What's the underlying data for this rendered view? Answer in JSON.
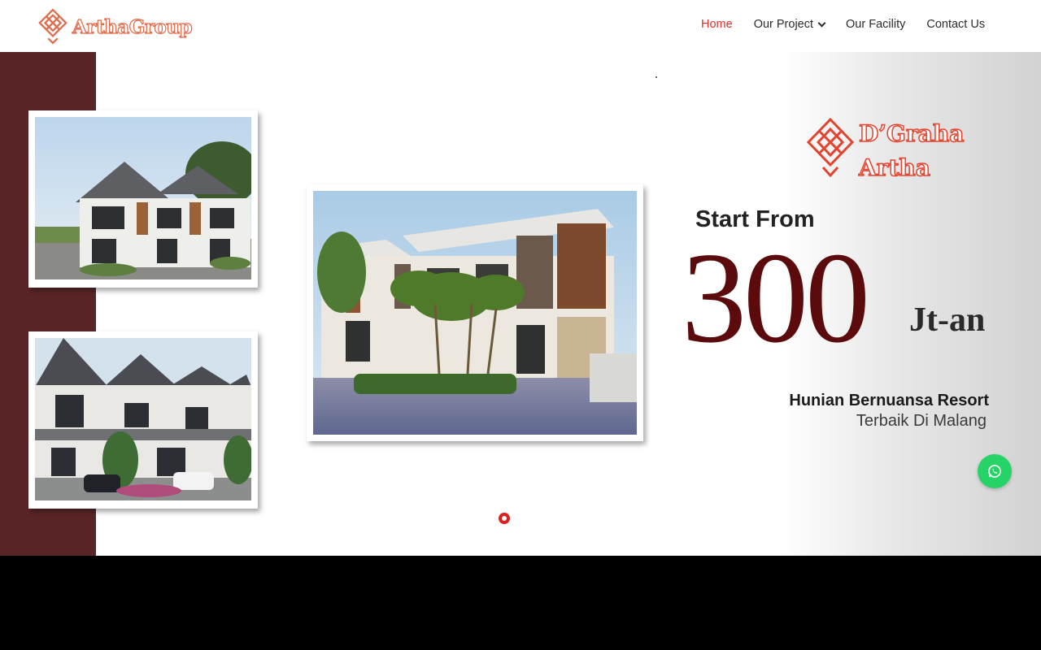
{
  "header": {
    "logo_text": "ArthaGroup",
    "nav": [
      {
        "label": "Home",
        "active": true
      },
      {
        "label": "Our Project",
        "has_dropdown": true
      },
      {
        "label": "Our Facility"
      },
      {
        "label": "Contact Us"
      }
    ]
  },
  "hero": {
    "brand_line1": "D’Graha",
    "brand_line2": "Artha",
    "start_from": "Start From",
    "price": "300",
    "price_unit": "Jt-an",
    "tagline_bold": "Hunian Bernuansa Resort",
    "tagline_light": "Terbaik Di Malang",
    "images": [
      "house-render-1",
      "house-render-2",
      "house-render-main"
    ]
  },
  "colors": {
    "accent": "#d6322d",
    "maroon": "#5a2527",
    "price": "#5b0b0b",
    "whatsapp": "#25d366"
  },
  "icons": {
    "logo": "endless-knot-icon",
    "whatsapp": "whatsapp-icon"
  }
}
